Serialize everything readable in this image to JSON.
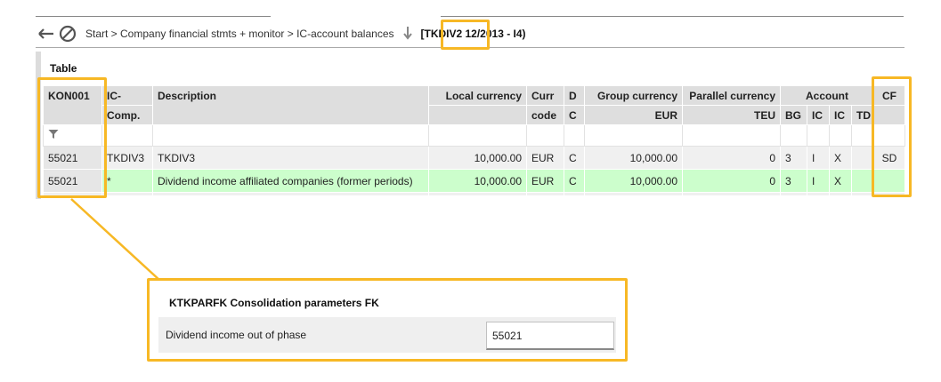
{
  "toolbar": {
    "breadcrumb": "Start > Company financial stmts + monitor > IC-account balances",
    "context": "[TKDIV2  12/2013 - I4)",
    "back_icon": "arrow-left-icon",
    "cancel_icon": "ban-icon",
    "down_icon": "arrow-down-icon"
  },
  "table": {
    "title": "Table",
    "headers": {
      "kon": "KON001",
      "ic_comp_1": "IC-",
      "ic_comp_2": "Comp.",
      "description": "Description",
      "local": "Local currency",
      "curr_1": "Curr",
      "curr_2": "code",
      "dc_1": "D",
      "dc_2": "C",
      "group_1": "Group currency",
      "group_2": "EUR",
      "parallel_1": "Parallel currency",
      "parallel_2": "TEU",
      "account": "Account",
      "bg": "BG",
      "ic1": "IC",
      "ic2": "IC",
      "td": "TD",
      "cf": "CF"
    },
    "rows": [
      {
        "kon": "55021",
        "ic_comp": "TKDIV3",
        "description": "TKDIV3",
        "local": "10,000.00",
        "curr": "EUR",
        "dc": "C",
        "group": "10,000.00",
        "parallel": "0",
        "bg": "3",
        "ic1": "I",
        "ic2": "X",
        "td": "",
        "cf": "SD"
      },
      {
        "kon": "55021",
        "ic_comp": "*",
        "description": "Dividend income affiliated companies (former periods)",
        "local": "10,000.00",
        "curr": "EUR",
        "dc": "C",
        "group": "10,000.00",
        "parallel": "0",
        "bg": "3",
        "ic1": "I",
        "ic2": "X",
        "td": "",
        "cf": ""
      }
    ]
  },
  "detail": {
    "title": "KTKPARFK Consolidation parameters FK",
    "label": "Dividend income out of phase",
    "value": "55021"
  },
  "colors": {
    "highlight": "#f7b825",
    "row_green": "#ccfecc",
    "header_bg": "#dedede"
  }
}
